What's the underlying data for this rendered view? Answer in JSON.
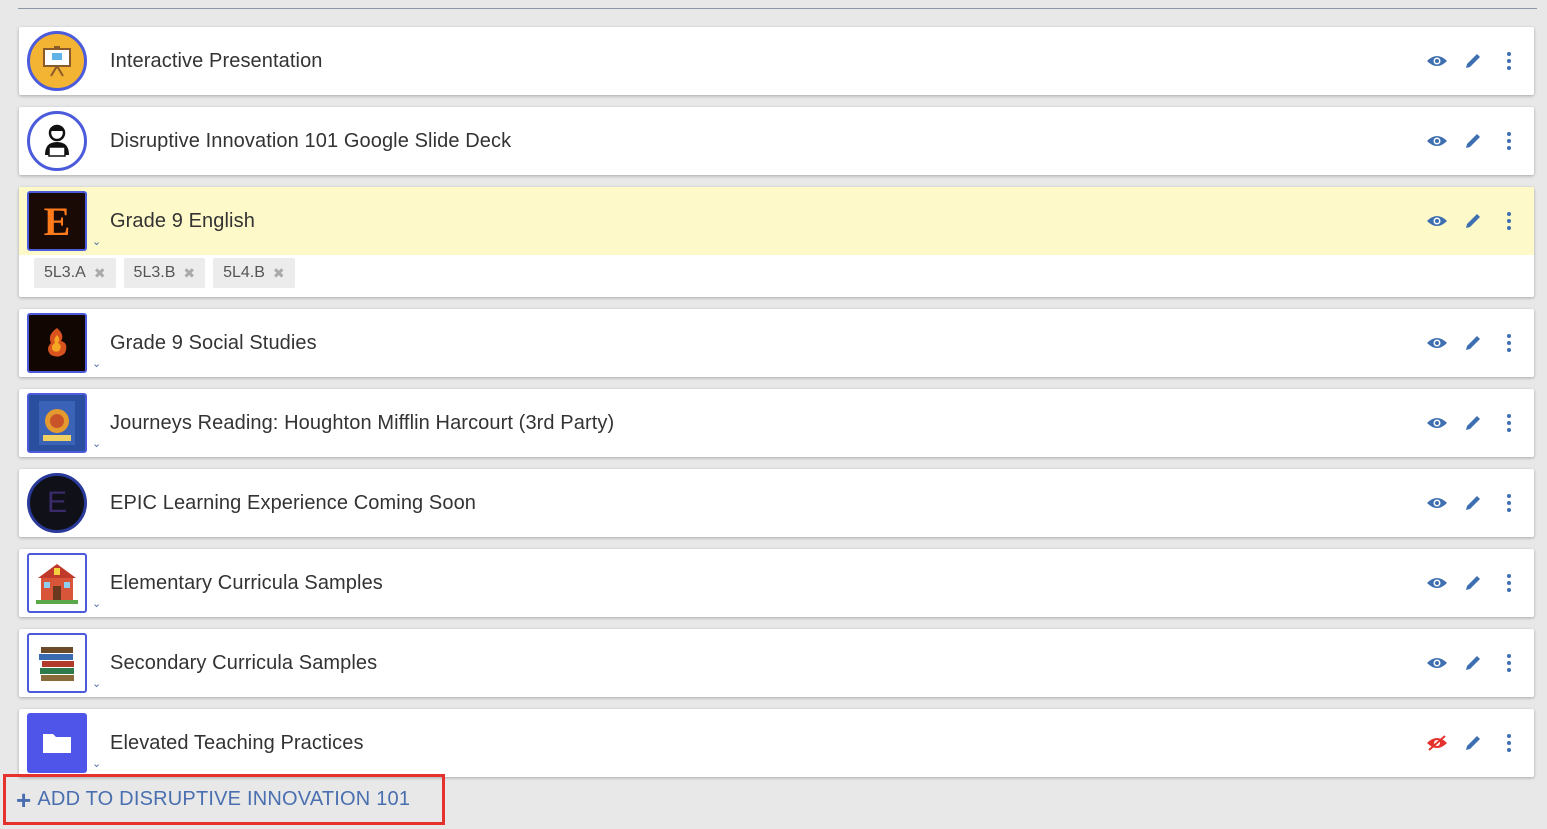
{
  "items": [
    {
      "title": "Interactive Presentation",
      "thumb_icon": "presentation-easel-icon",
      "visible": true
    },
    {
      "title": "Disruptive Innovation 101 Google Slide Deck",
      "thumb_icon": "person-laptop-icon",
      "visible": true
    },
    {
      "title": "Grade 9 English",
      "thumb_icon": "letter-e-icon",
      "thumb_letter": "E",
      "visible": true,
      "highlighted": true,
      "tags": [
        {
          "label": "5L3.A"
        },
        {
          "label": "5L3.B"
        },
        {
          "label": "5L4.B"
        }
      ]
    },
    {
      "title": "Grade 9 Social Studies",
      "thumb_icon": "fire-emblem-icon",
      "visible": true
    },
    {
      "title": "Journeys Reading: Houghton Mifflin Harcourt (3rd Party)",
      "thumb_icon": "book-cover-icon",
      "visible": true
    },
    {
      "title": "EPIC Learning Experience Coming Soon",
      "thumb_icon": "epic-e-logo-icon",
      "visible": true
    },
    {
      "title": "Elementary Curricula Samples",
      "thumb_icon": "schoolhouse-icon",
      "visible": true
    },
    {
      "title": "Secondary Curricula Samples",
      "thumb_icon": "book-stack-icon",
      "visible": true
    },
    {
      "title": "Elevated Teaching Practices",
      "thumb_icon": "folder-icon",
      "visible": false
    }
  ],
  "add_button": {
    "label": "ADD TO DISRUPTIVE INNOVATION 101",
    "icon": "plus-icon"
  },
  "colors": {
    "accent": "#4a6fb0",
    "highlight_row": "#fdf9c8",
    "hidden_eye": "#e5322d",
    "callout_border": "#e5322d",
    "action_icon": "#3e6fb0"
  }
}
